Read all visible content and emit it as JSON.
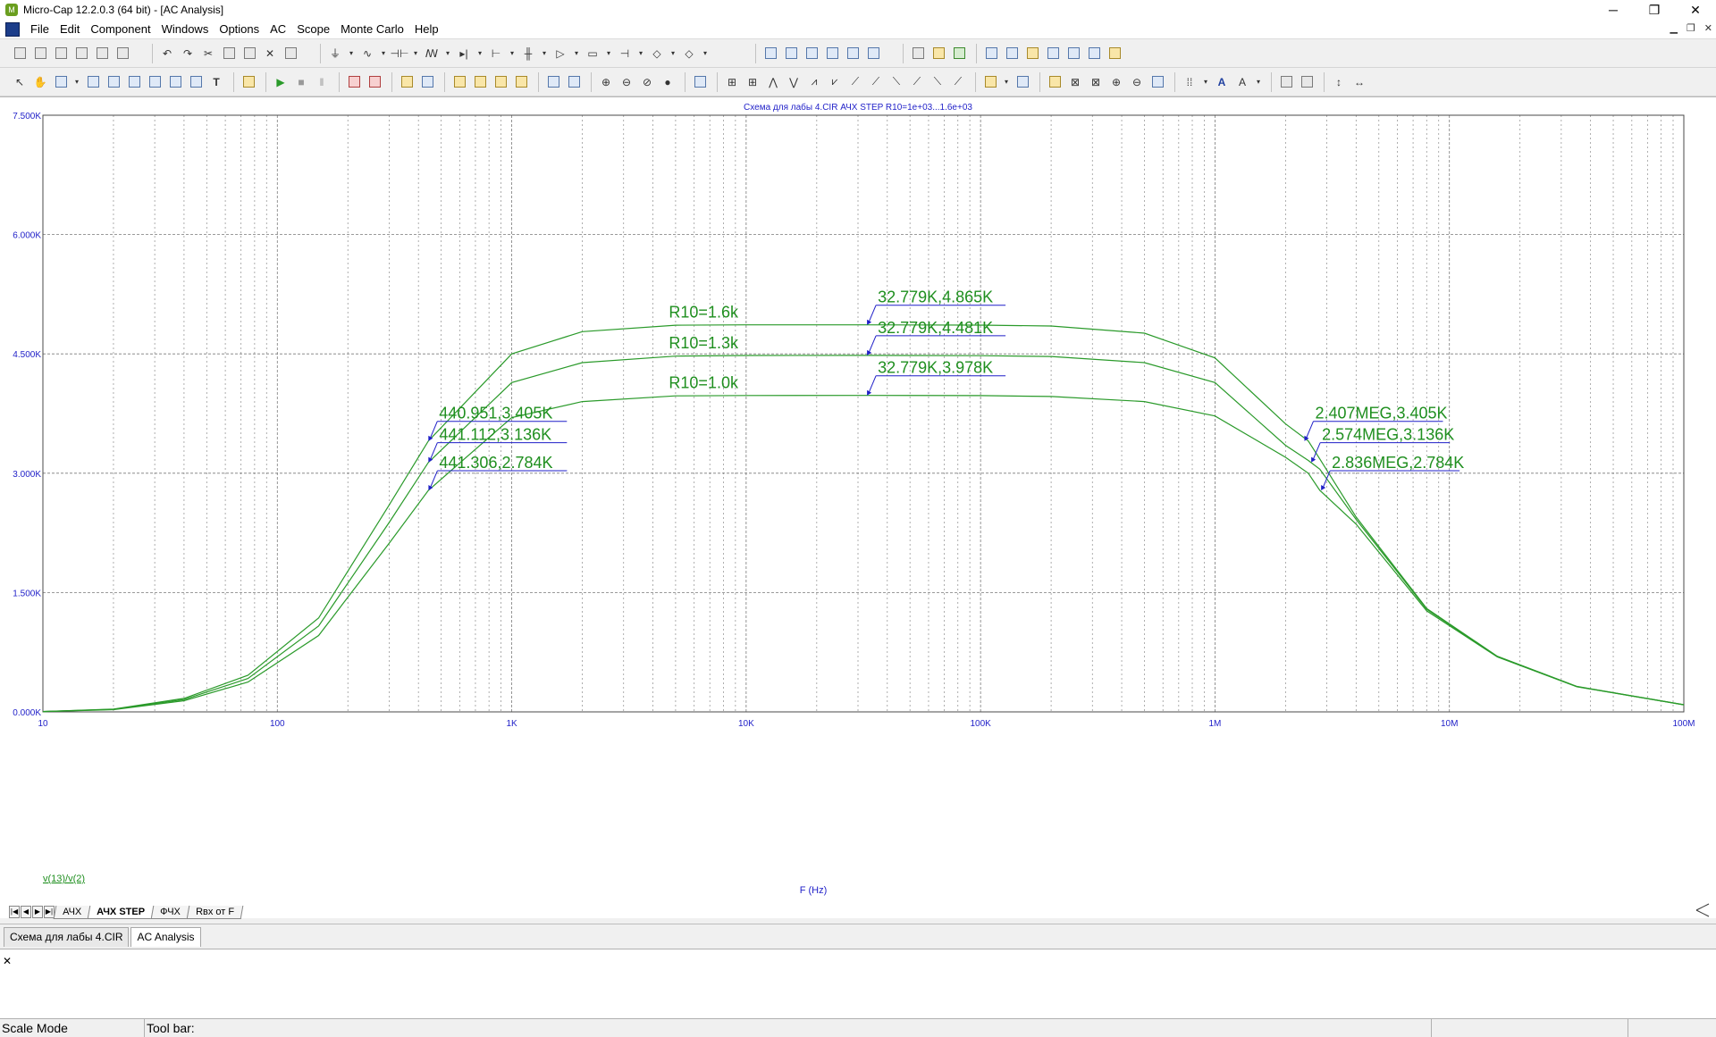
{
  "window": {
    "title": "Micro-Cap 12.2.0.3 (64 bit) - [AC Analysis]",
    "minimize": "─",
    "restore": "❐",
    "close": "✕"
  },
  "menu": [
    "File",
    "Edit",
    "Component",
    "Windows",
    "Options",
    "AC",
    "Scope",
    "Monte Carlo",
    "Help"
  ],
  "plot": {
    "title": "Схема для лабы 4.CIR АЧХ STEP R10=1e+03...1.6e+03",
    "trace_expr": "v(13)/v(2)",
    "curve_color": "#2a9a2a",
    "label_color": "#1f8f1f",
    "axis_text_color": "#1f1fc8"
  },
  "sheet_tabs": {
    "nav": [
      "|◀",
      "◀",
      "▶",
      "▶|"
    ],
    "tabs": [
      {
        "label": "АЧХ",
        "active": false
      },
      {
        "label": "АЧХ STEP",
        "active": true
      },
      {
        "label": "ФЧХ",
        "active": false
      },
      {
        "label": "Rвх от F",
        "active": false
      }
    ]
  },
  "doc_tabs": [
    {
      "label": "Схема для лабы 4.CIR",
      "active": false
    },
    {
      "label": "AC Analysis",
      "active": true
    }
  ],
  "status": {
    "mode": "Scale Mode",
    "toolbar_label": "Tool bar:"
  },
  "chart_data": {
    "type": "line",
    "title": "Схема для лабы 4.CIR АЧХ STEP R10=1e+03...1.6e+03",
    "xlabel": "F (Hz)",
    "ylabel": "v(13)/v(2)",
    "x_scale": "log",
    "xlim": [
      10,
      100000000
    ],
    "ylim": [
      0,
      7500
    ],
    "x_ticks": [
      {
        "v": 10,
        "label": "10"
      },
      {
        "v": 100,
        "label": "100"
      },
      {
        "v": 1000,
        "label": "1K"
      },
      {
        "v": 10000,
        "label": "10K"
      },
      {
        "v": 100000,
        "label": "100K"
      },
      {
        "v": 1000000,
        "label": "1M"
      },
      {
        "v": 10000000,
        "label": "10M"
      },
      {
        "v": 100000000,
        "label": "100M"
      }
    ],
    "y_ticks": [
      {
        "v": 0,
        "label": "0.000K"
      },
      {
        "v": 1500,
        "label": "1.500K"
      },
      {
        "v": 3000,
        "label": "3.000K"
      },
      {
        "v": 4500,
        "label": "4.500K"
      },
      {
        "v": 6000,
        "label": "6.000K"
      },
      {
        "v": 7500,
        "label": "7.500K"
      }
    ],
    "grid": true,
    "x": [
      10,
      20,
      40,
      75,
      150,
      300,
      441,
      1000,
      2000,
      5000,
      10000,
      32779,
      100000,
      200000,
      500000,
      1000000,
      2000000,
      2500000,
      2800000,
      4000000,
      8000000,
      16000000,
      35000000,
      100000000
    ],
    "series": [
      {
        "name": "R10=1.6k",
        "values": [
          5,
          35,
          170,
          460,
          1180,
          2600,
          3405,
          4500,
          4780,
          4860,
          4865,
          4865,
          4862,
          4850,
          4760,
          4450,
          3620,
          3405,
          3180,
          2450,
          1300,
          700,
          320,
          90
        ]
      },
      {
        "name": "R10=1.3k",
        "values": [
          5,
          32,
          155,
          420,
          1080,
          2380,
          3136,
          4140,
          4390,
          4472,
          4480,
          4481,
          4478,
          4468,
          4390,
          4140,
          3350,
          3160,
          3050,
          2420,
          1290,
          695,
          318,
          90
        ]
      },
      {
        "name": "R10=1.0k",
        "values": [
          4,
          28,
          140,
          375,
          960,
          2120,
          2784,
          3700,
          3900,
          3972,
          3977,
          3978,
          3976,
          3965,
          3900,
          3720,
          3200,
          3000,
          2784,
          2360,
          1270,
          690,
          316,
          89
        ]
      }
    ],
    "annotations": [
      {
        "text": "R10=1.6k",
        "x": 10500,
        "y": 4865
      },
      {
        "text": "R10=1.3k",
        "x": 10500,
        "y": 4481
      },
      {
        "text": "R10=1.0k",
        "x": 10500,
        "y": 3978
      },
      {
        "text": "32.779K,4.865K",
        "x": 32779,
        "y": 4865
      },
      {
        "text": "32.779K,4.481K",
        "x": 32779,
        "y": 4481
      },
      {
        "text": "32.779K,3.978K",
        "x": 32779,
        "y": 3978
      },
      {
        "text": "440.951,3.405K",
        "x": 440.951,
        "y": 3405
      },
      {
        "text": "441.112,3.136K",
        "x": 441.112,
        "y": 3136
      },
      {
        "text": "441.306,2.784K",
        "x": 441.306,
        "y": 2784
      },
      {
        "text": "2.407MEG,3.405K",
        "x": 2407000,
        "y": 3405
      },
      {
        "text": "2.574MEG,3.136K",
        "x": 2574000,
        "y": 3136
      },
      {
        "text": "2.836MEG,2.784K",
        "x": 2836000,
        "y": 2784
      }
    ]
  }
}
